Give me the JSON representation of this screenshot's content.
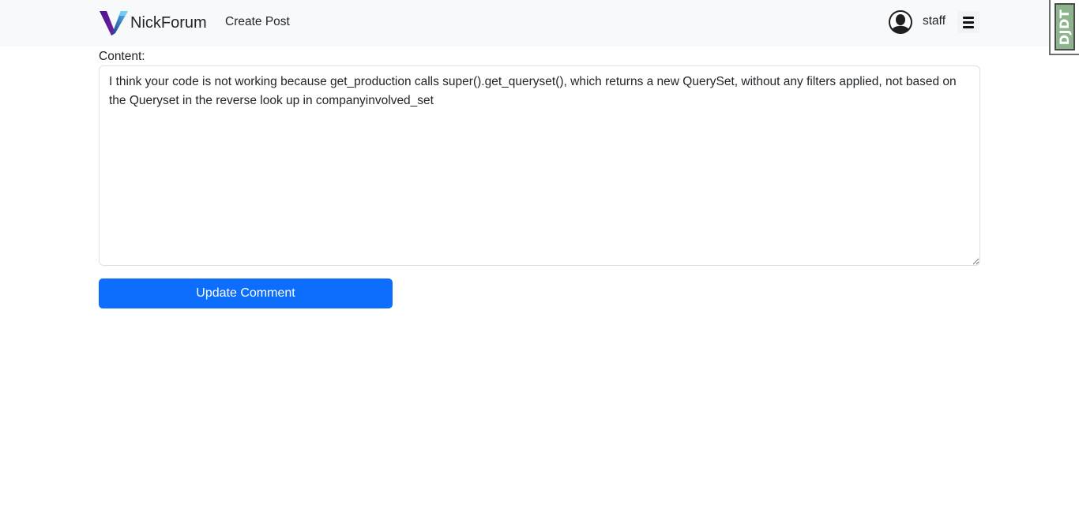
{
  "navbar": {
    "brand_name": "NickForum",
    "create_post_link": "Create Post",
    "username": "staff",
    "logo_icon": "nickforum-v-logo",
    "avatar_icon": "user-avatar-icon",
    "menu_icon": "hamburger-menu-icon"
  },
  "debug_toolbar": {
    "handle_label": "DJDT"
  },
  "form": {
    "content_label": "Content:",
    "content_value": "I think your code is not working because get_production calls super().get_queryset(), which returns a new QuerySet, without any filters applied, not based on the Queryset in the reverse look up in companyinvolved_set",
    "submit_label": "Update Comment"
  },
  "colors": {
    "navbar_bg": "#f8f9fa",
    "primary": "#0d6efd",
    "logo_gradient_start": "#6a1b9a",
    "logo_gradient_end": "#29b6f6"
  }
}
